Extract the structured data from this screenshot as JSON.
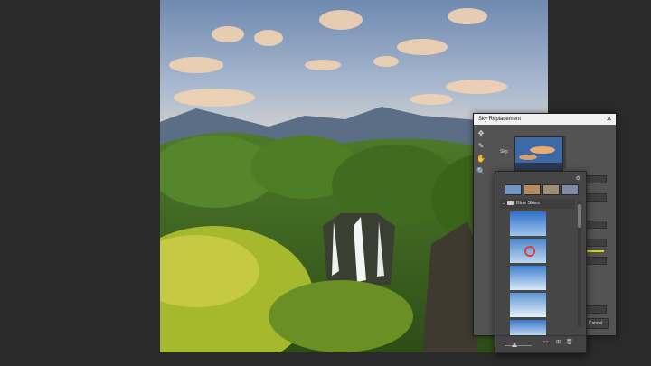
{
  "dialog": {
    "title": "Sky Replacement",
    "close_glyph": "✕",
    "sky_label": "Sky:",
    "cancel_label": "Cancel",
    "tools": [
      {
        "icon": "move-icon",
        "glyph": "✥"
      },
      {
        "icon": "brush-icon",
        "glyph": "✎"
      },
      {
        "icon": "hand-icon",
        "glyph": "✋"
      },
      {
        "icon": "zoom-icon",
        "glyph": "🔍"
      }
    ]
  },
  "sky_picker": {
    "folder_label": "Blue Skies",
    "folder_icon": "folder-icon",
    "settings_icon": "gear-icon",
    "bottom_icons": [
      "new-folder-icon",
      "new-preset-icon",
      "delete-icon"
    ],
    "thumbnail_count": 4,
    "sky_count": 5
  },
  "colors": {
    "workspace": "#2a2a2a",
    "dialog_bg": "#535353",
    "popup_bg": "#464646",
    "titlebar": "#f0f0f0"
  }
}
